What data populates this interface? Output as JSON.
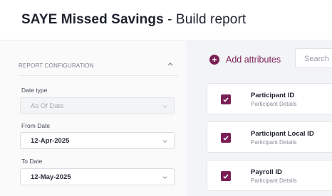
{
  "header": {
    "title_bold": "SAYE Missed Savings",
    "title_rest": " - Build report"
  },
  "sidebar": {
    "section_title": "REPORT CONFIGURATION",
    "fields": [
      {
        "label": "Date type",
        "value": "As Of Date",
        "disabled": true
      },
      {
        "label": "From Date",
        "value": "12-Apr-2025",
        "disabled": false
      },
      {
        "label": "To Date",
        "value": "12-May-2025",
        "disabled": false
      }
    ]
  },
  "content": {
    "add_attributes_label": "Add attributes",
    "search_placeholder": "Search",
    "attributes": [
      {
        "title": "Participant ID",
        "subtitle": "Participant Details",
        "checked": true
      },
      {
        "title": "Participant Local ID",
        "subtitle": "Participant Details",
        "checked": true
      },
      {
        "title": "Payroll ID",
        "subtitle": "Participant Details",
        "checked": true
      }
    ]
  },
  "colors": {
    "accent": "#7a1f55",
    "sidebar_bg": "#fafafb",
    "content_bg": "#f3f4f6"
  },
  "icons": {
    "collapse": "chevron-up-icon",
    "dropdown": "chevron-down-icon",
    "add": "plus-circle-icon",
    "checked": "check-icon"
  }
}
